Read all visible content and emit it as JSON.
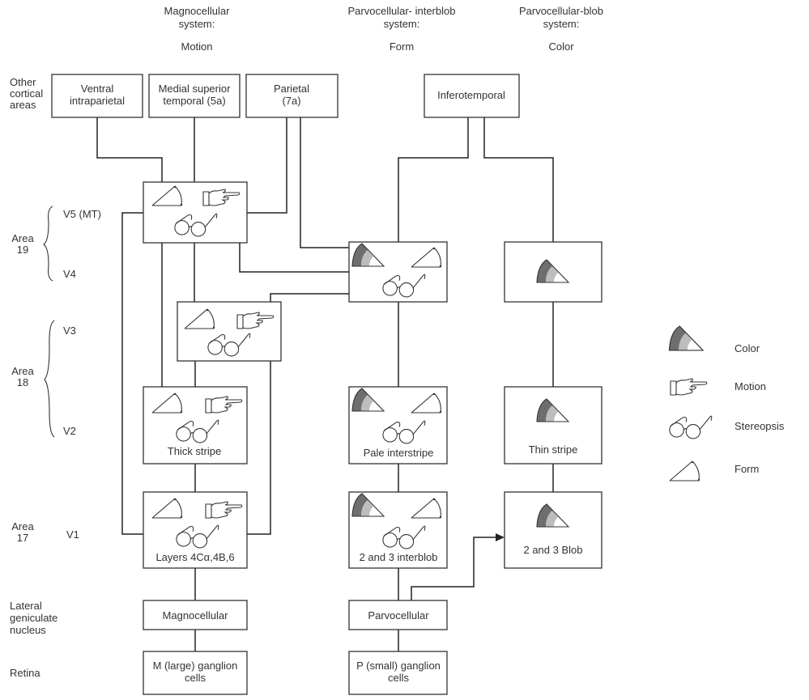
{
  "headers": [
    {
      "line1": "Magnocellular",
      "line2": "system:",
      "function": "Motion"
    },
    {
      "line1": "Parvocellular- interblob",
      "line2": "system:",
      "function": "Form"
    },
    {
      "line1": "Parvocellular-blob",
      "line2": "system:",
      "function": "Color"
    }
  ],
  "row_labels": {
    "other_cortical": [
      "Other",
      "cortical",
      "areas"
    ],
    "area19": [
      "Area",
      "19"
    ],
    "v5": "V5  (MT)",
    "v4": "V4",
    "area18": [
      "Area",
      "18"
    ],
    "v3": "V3",
    "v2": "V2",
    "area17": [
      "Area",
      "17"
    ],
    "v1": "V1",
    "lgn": [
      "Lateral",
      "geniculate",
      "nucleus"
    ],
    "retina": "Retina"
  },
  "boxes": {
    "vip": [
      "Ventral",
      "intraparietal"
    ],
    "mst": [
      "Medial superior",
      "temporal (5a)"
    ],
    "parietal": [
      "Parietal",
      "(7a)"
    ],
    "inferotemporal": "Inferotemporal",
    "thick_stripe": "Thick stripe",
    "pale_interstripe": "Pale interstripe",
    "thin_stripe": "Thin stripe",
    "v1_magno": "Layers 4Cα,4B,6",
    "v1_interblob": "2 and 3 interblob",
    "v1_blob": "2 and 3 Blob",
    "lgn_magno": "Magnocellular",
    "lgn_parvo": "Parvocellular",
    "retina_m": [
      "M (large) ganglion",
      "cells"
    ],
    "retina_p": [
      "P (small) ganglion",
      "cells"
    ]
  },
  "legend": [
    {
      "icon": "color-sector-icon",
      "label": "Color"
    },
    {
      "icon": "pointing-hand-icon",
      "label": "Motion"
    },
    {
      "icon": "glasses-icon",
      "label": "Stereopsis"
    },
    {
      "icon": "angle-triangle-icon",
      "label": "Form"
    }
  ],
  "colors": {
    "dark_band": "#6e6e6e",
    "light_band": "#bdbdbd",
    "line": "#222222"
  }
}
